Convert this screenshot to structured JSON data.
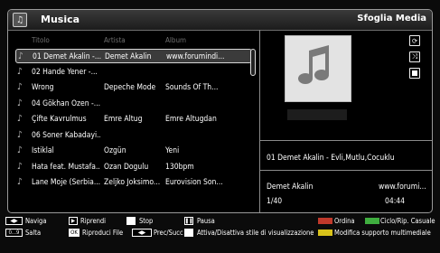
{
  "header": {
    "title": "Musica",
    "browse_label": "Sfoglia Media"
  },
  "columns": {
    "title": "Titolo",
    "artist": "Artista",
    "album": "Album"
  },
  "rows": [
    {
      "title": "01 Demet Akalin -...",
      "artist": "Demet Akalin",
      "album": "www.forumindi...",
      "selected": true
    },
    {
      "title": "02 Hande Yener -...",
      "artist": "",
      "album": ""
    },
    {
      "title": "Wrong",
      "artist": "Depeche Mode",
      "album": "Sounds Of Th..."
    },
    {
      "title": "04 Gökhan Özen -...",
      "artist": "",
      "album": ""
    },
    {
      "title": "Çifte Kavrulmus",
      "artist": "Emre Altug",
      "album": "Emre Altugdan"
    },
    {
      "title": "06 Soner Kabadayi...",
      "artist": "",
      "album": ""
    },
    {
      "title": "Istiklal",
      "artist": "Özgün",
      "album": "Yeni"
    },
    {
      "title": "Hata feat. Mustafa...",
      "artist": "Ozan Dogulu",
      "album": "130bpm"
    },
    {
      "title": "Lane Moje (Serbia...",
      "artist": "Zeljko Joksimo...",
      "album": "Eurovision Son..."
    }
  ],
  "now_playing": {
    "track": "01 Demet Akalin - Evli,Mutlu,Cocuklu",
    "artist": "Demet Akalin",
    "album": "www.forumi...",
    "position": "1/40",
    "duration": "04:44"
  },
  "side_controls": [
    "repeat-icon",
    "shuffle-icon",
    "stop-square-icon"
  ],
  "legend": {
    "navigate": "Naviga",
    "play": "Riprendi",
    "stop": "Stop",
    "pause": "Pausa",
    "order": "Ordina",
    "loop_shuffle": "Ciclo/Rip. Casuale",
    "jump_key": "0...9",
    "jump": "Salta",
    "ok_key": "OK",
    "play_file": "Riproduci File",
    "prev_next": "Prec/Succ",
    "toggle_style": "Attiva/Disattiva stile di visualizzazione",
    "change_media": "Modifica supporto multimediale"
  },
  "colors": {
    "red_key": "#c0392b",
    "green_key": "#3fae3f",
    "yellow_key": "#d8c21a",
    "blue_key": "#3a6fd8"
  }
}
